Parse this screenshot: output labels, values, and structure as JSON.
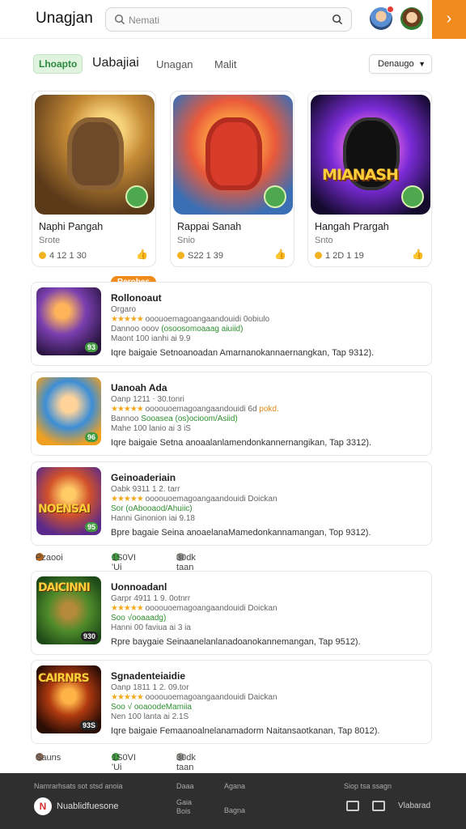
{
  "header": {
    "logo": "Unagjan",
    "search_placeholder": "Nemati",
    "orange_tab_icon": "›"
  },
  "tabs": {
    "active": "Lhoapto",
    "items": [
      "Uabajiai",
      "Unagan",
      "Malit"
    ],
    "dropdown": "Denaugo"
  },
  "featured": [
    {
      "title": "Naphi Pangah",
      "sub": "Srote",
      "meta": "4 12 1 30",
      "overtext": ""
    },
    {
      "title": "Rappai Sanah",
      "sub": "Snio",
      "meta": "S22 1 39",
      "overtext": ""
    },
    {
      "title": "Hangah Prargah",
      "sub": "Snto",
      "meta": "1 2D 1 19",
      "overtext": "MIANASH"
    }
  ],
  "new_tag": "Rerobes",
  "list": [
    {
      "title": "Rollonoaut",
      "l1": "Orgaro",
      "stars": "★★★★★",
      "l2text": "ooouoemagoangaandouidi 0obiulo",
      "l3": "Dannoo ooov",
      "l3green": "(osoosomoaaag aiuiid)",
      "l4": "Maont 100 ianhi ai 9.9",
      "l5": "Iqre baigaie Setnoanoadan Amarnanokannaernangkan, Tap 9312).",
      "badge": "93",
      "overtext": ""
    },
    {
      "title": "Uanoah Ada",
      "l1": "Oanp 1211 ⋅ 30.tonri",
      "stars": "★★★★★",
      "l2text": "oooouoemagoangaandouidi 6d",
      "l2orange": "pokd.",
      "l3": "Bannoo",
      "l3green": "Sooasea (os)ocioom/Asiid)",
      "l4": "Mahe 100 lanio ai 3 iS",
      "l5": "Iqre baigaie Setna anoaalanlamendonkannernangikan, Tap 3312).",
      "badge": "96",
      "overtext": ""
    },
    {
      "title": "Geinoaderiain",
      "l1": "Oabk 9311 1 2. tarr",
      "stars": "★★★★★",
      "l2text": "oooouoemagoangaandouidi Doickan",
      "l3": "",
      "l3green": "Sor (oAbooaod/Ahuiic)",
      "l4": "Hanni Ginonion iai 9.18",
      "l5": "Bpre bagaie Seina anoaelanaMamedonkannamangan, Top 9312).",
      "badge": "95",
      "overtext": "NOENSAI"
    },
    {
      "title": "Uonnoadanl",
      "l1": "Garpr 4911 1 9. 0otnrr",
      "stars": "★★★★★",
      "l2text": "oooouoemagoangaandouidi Doickan",
      "l3": "",
      "l3green": "Soo √ooaaadg)",
      "l4": "Hanni 00 faviua ai 3 ia",
      "l5": "Rpre baygaie Seinaanelanlanadoanokannemangan, Tap 9512).",
      "badge": "930",
      "overtext": "DAICINNI"
    },
    {
      "title": "Sgnadenteiaidie",
      "l1": "Oanp 1811 1 2. 09.tor",
      "stars": "★★★★★",
      "l2text": "oooouoemagoangaandouidi Daickan",
      "l3": "",
      "l3green": "Soo √ ooaoodeMamiia",
      "l4": "Nen 100 lanta ai 2.1S",
      "l5": "Iqre baigaie Femaanoalnelanamadorm Naitansaotkanan, Tap 8012).",
      "badge": "93S",
      "overtext": "CAIRNRS"
    }
  ],
  "stats_rows": [
    {
      "a": "Pzaooi",
      "b": "1S0VI  'Ui",
      "c": "30dk taan"
    },
    {
      "a": "Sauns",
      "b": "1S0VI  'Ui",
      "c": "30dk taan"
    }
  ],
  "footer": {
    "top_left": "Namrarhsats  sot stsd anoia",
    "col1a": "Daaa",
    "col2a": "Agana",
    "col1b": "Gaia",
    "col1c": "Bois",
    "col2b": "Bagna",
    "right_top": "Siop tsa ssagn",
    "brand": "Nuablidfuesone",
    "right_brand": "Vlabarad",
    "logo_letter": "N"
  },
  "colors": {
    "accent": "#f08a1c",
    "green": "#2f8f2f",
    "star": "#f2a91e"
  }
}
